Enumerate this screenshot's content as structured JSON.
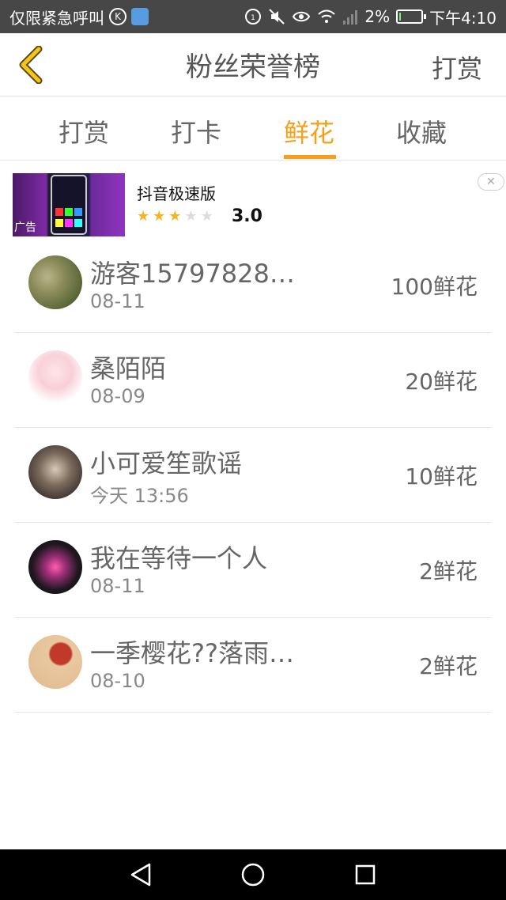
{
  "status_bar": {
    "left_text": "仅限紧急呼叫",
    "battery_percent": "2%",
    "battery_level": 0.02,
    "time": "下午4:10",
    "icons": [
      "k-badge-icon",
      "app-icon",
      "hd-call-icon",
      "mute-icon",
      "eye-icon",
      "wifi-icon",
      "signal-icon",
      "battery-icon"
    ]
  },
  "header": {
    "title": "粉丝荣誉榜",
    "right_action": "打赏"
  },
  "tabs": [
    {
      "label": "打赏",
      "active": false
    },
    {
      "label": "打卡",
      "active": false
    },
    {
      "label": "鲜花",
      "active": true
    },
    {
      "label": "收藏",
      "active": false
    }
  ],
  "ad": {
    "label": "广告",
    "app_name": "抖音极速版",
    "rating": "3.0",
    "stars_filled": 3,
    "stars_total": 5
  },
  "fans": [
    {
      "name": "游客15797828…",
      "date": "08-11",
      "amount": "100鲜花"
    },
    {
      "name": "桑陌陌",
      "date": "08-09",
      "amount": "20鲜花"
    },
    {
      "name": "小可爱笙歌谣",
      "date": "今天 13:56",
      "amount": "10鲜花"
    },
    {
      "name": "我在等待一个人",
      "date": "08-11",
      "amount": "2鲜花"
    },
    {
      "name": "一季樱花??落雨…",
      "date": "08-10",
      "amount": "2鲜花"
    }
  ],
  "colors": {
    "accent": "#f6a019",
    "status_bar_bg": "#474747",
    "nav_bar_bg": "#000000",
    "star_on": "#f6b21f"
  }
}
